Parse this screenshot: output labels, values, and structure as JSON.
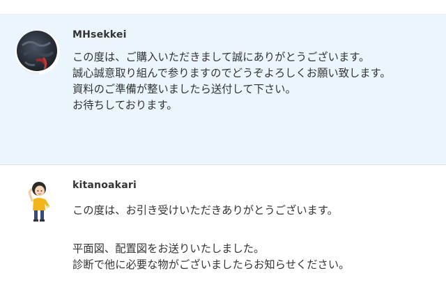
{
  "messages": [
    {
      "username": "MHsekkei",
      "avatar": "dark-abstract-avatar",
      "lines": [
        "この度は、ご購入いただきまして誠にありがとうございます。",
        "誠心誠意取り組んで参りますのでどうぞよろしくお願い致します。",
        "資料のご準備が整いましたら送付して下さい。",
        "お待ちしております。"
      ]
    },
    {
      "username": "kitanoakari",
      "avatar": "person-illustration-avatar",
      "lines": [
        "この度は、お引き受けいただきありがとうございます。",
        "",
        "平面図、配置図をお送りいたしました。",
        "診断で他に必要な物がございましたらお知らせください。"
      ]
    }
  ],
  "colors": {
    "highlight_bg": "#eaf5fc",
    "text": "#333333",
    "divider": "#dde3e7"
  }
}
